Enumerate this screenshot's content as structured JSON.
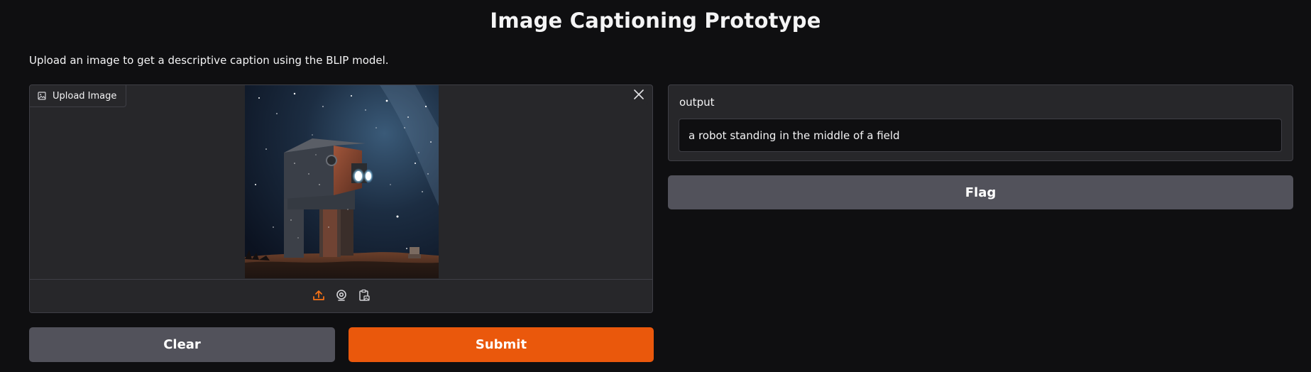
{
  "header": {
    "title": "Image Captioning Prototype",
    "description": "Upload an image to get a descriptive caption using the BLIP model."
  },
  "image_input": {
    "label": "Upload Image",
    "label_icon": "image-icon",
    "clear_icon": "close-icon",
    "sources": [
      {
        "name": "upload",
        "icon": "upload-icon",
        "active": true
      },
      {
        "name": "webcam",
        "icon": "webcam-icon",
        "active": false
      },
      {
        "name": "clipboard",
        "icon": "clipboard-icon",
        "active": false
      }
    ]
  },
  "buttons": {
    "clear_label": "Clear",
    "submit_label": "Submit",
    "flag_label": "Flag"
  },
  "output": {
    "label": "output",
    "value": "a robot standing in the middle of a field"
  },
  "colors": {
    "background": "#0f0f11",
    "panel": "#27272a",
    "border": "#3f3f46",
    "primary": "#ea580c",
    "secondary": "#52525b",
    "text": "#f4f4f5"
  }
}
